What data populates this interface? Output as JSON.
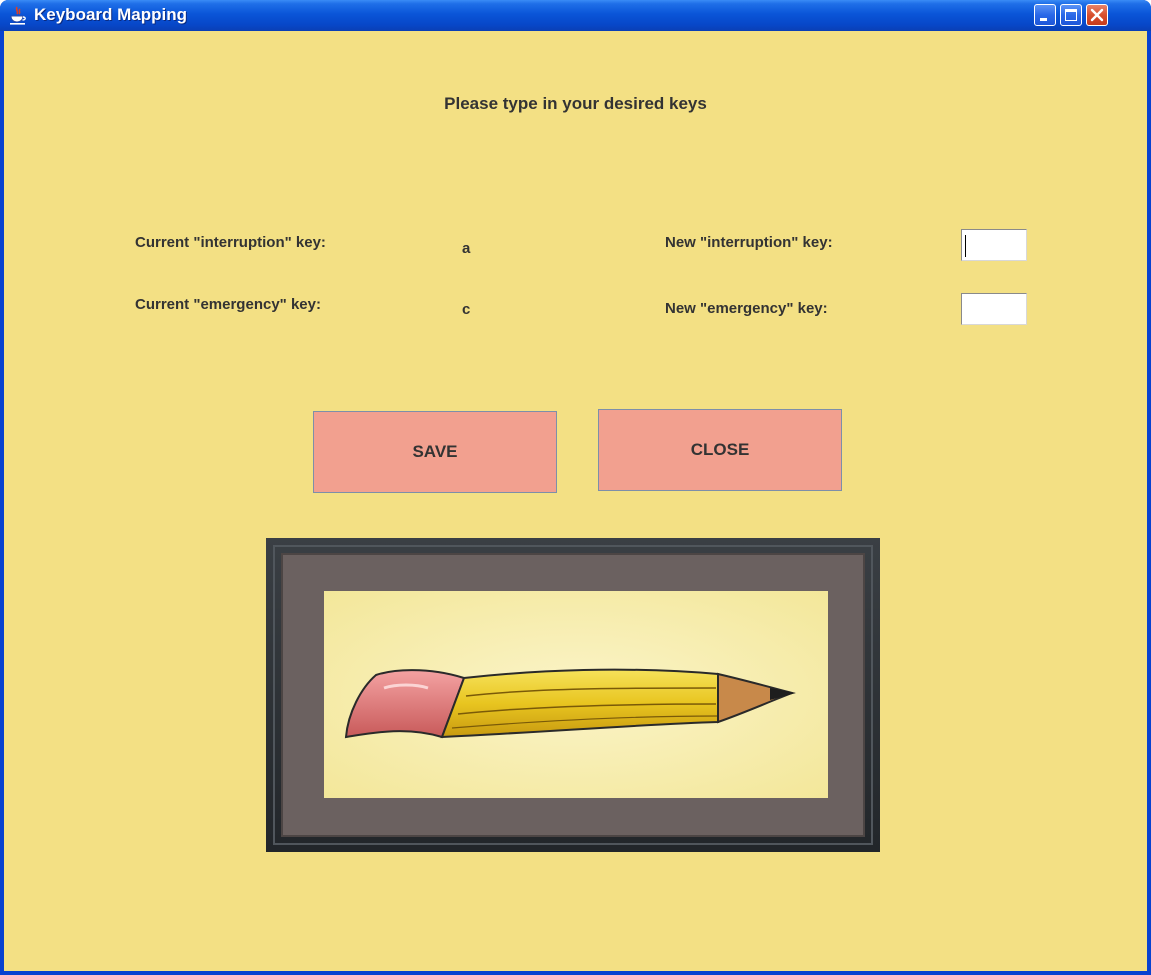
{
  "window": {
    "title": "Keyboard Mapping",
    "icon": "java-cup-icon",
    "controls": {
      "minimize": "minimize-icon",
      "maximize": "maximize-icon",
      "close": "close-icon"
    }
  },
  "heading": "Please type in your desired keys",
  "current": {
    "interruption_label": "Current \"interruption\" key:",
    "interruption_value": "a",
    "emergency_label": "Current \"emergency\" key:",
    "emergency_value": "c"
  },
  "new": {
    "interruption_label": "New \"interruption\" key:",
    "interruption_value": "",
    "emergency_label": "New \"emergency\" key:",
    "emergency_value": ""
  },
  "buttons": {
    "save": "SAVE",
    "close": "CLOSE"
  },
  "picture": {
    "subject": "pencil-illustration"
  },
  "colors": {
    "background": "#f3e084",
    "button": "#f2a08f",
    "titlebar": "#0a55d8"
  }
}
